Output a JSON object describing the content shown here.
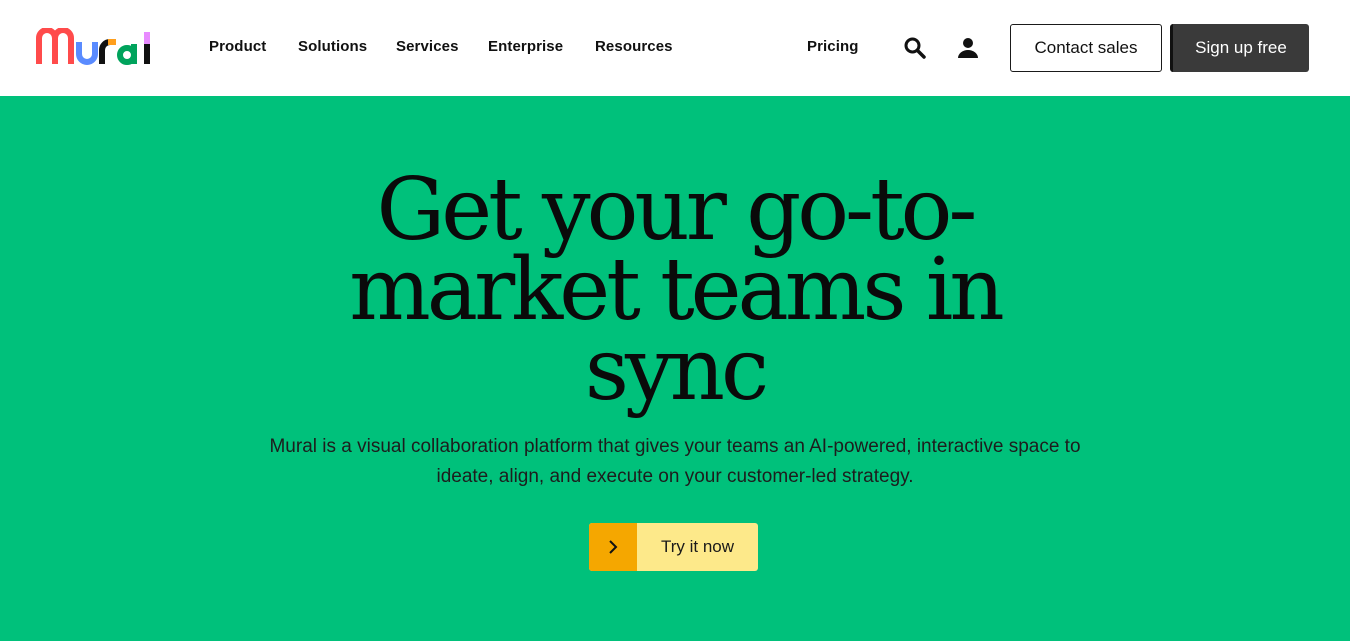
{
  "header": {
    "logo_text": "Mural",
    "nav": [
      "Product",
      "Solutions",
      "Services",
      "Enterprise",
      "Resources"
    ],
    "pricing": "Pricing",
    "search_icon": "search-icon",
    "account_icon": "user-icon",
    "contact_label": "Contact sales",
    "signup_label": "Sign up free"
  },
  "hero": {
    "headline": "Get your go-to-market teams in sync",
    "subtext": "Mural is a visual collaboration platform that gives your teams an AI-powered, interactive space to ideate, align, and execute on your customer-led strategy.",
    "cta_label": "Try it now",
    "cta_icon": "chevron-right-icon"
  },
  "colors": {
    "hero_bg": "#00c17b",
    "cta_bg": "#fde98a",
    "cta_arrow_bg": "#f5a700",
    "signup_bg": "#3a3a3a",
    "logo_red": "#ff4b4b",
    "logo_blue": "#5a8bff",
    "logo_orange": "#ff9f1c",
    "logo_green": "#00a35c",
    "logo_pink": "#e88bff"
  }
}
